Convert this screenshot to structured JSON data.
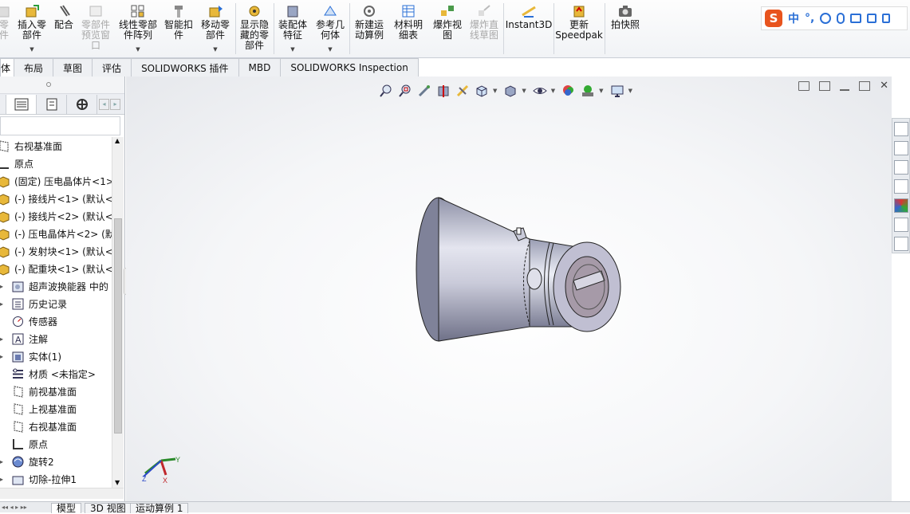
{
  "ribbon": {
    "buttons": [
      {
        "label": "零\n件",
        "disabled": true
      },
      {
        "label": "插入零\n部件",
        "disabled": false
      },
      {
        "label": "配合",
        "disabled": false
      },
      {
        "label": "零部件\n预览窗\n口",
        "disabled": true
      },
      {
        "label": "线性零部\n件阵列",
        "disabled": false
      },
      {
        "label": "智能扣\n件",
        "disabled": false
      },
      {
        "label": "移动零\n部件",
        "disabled": false
      },
      {
        "label": "显示隐\n藏的零\n部件",
        "disabled": false
      },
      {
        "label": "装配体\n特征",
        "disabled": false
      },
      {
        "label": "参考几\n何体",
        "disabled": false
      },
      {
        "label": "新建运\n动算例",
        "disabled": false
      },
      {
        "label": "材料明\n细表",
        "disabled": false
      },
      {
        "label": "爆炸视\n图",
        "disabled": false
      },
      {
        "label": "爆炸直\n线草图",
        "disabled": true
      },
      {
        "label": "Instant3D",
        "disabled": false
      },
      {
        "label": "更新\nSpeedpak",
        "disabled": false
      },
      {
        "label": "拍快照",
        "disabled": false
      }
    ]
  },
  "ime": {
    "mode": "中",
    "punct": "°,"
  },
  "tabs": [
    "体",
    "布局",
    "草图",
    "评估",
    "SOLIDWORKS 插件",
    "MBD",
    "SOLIDWORKS Inspection"
  ],
  "tree": [
    {
      "label": "右视基准面",
      "icon": "plane-icon"
    },
    {
      "label": "原点",
      "icon": "origin-icon"
    },
    {
      "label": "(固定) 压电晶体片<1>",
      "icon": "part-icon"
    },
    {
      "label": "(-) 接线片<1> (默认<",
      "icon": "part-icon"
    },
    {
      "label": "(-) 接线片<2> (默认<",
      "icon": "part-icon"
    },
    {
      "label": "(-) 压电晶体片<2> (默",
      "icon": "part-icon"
    },
    {
      "label": "(-) 发射块<1> (默认<",
      "icon": "part-icon"
    },
    {
      "label": "(-) 配重块<1> (默认<",
      "icon": "part-icon"
    },
    {
      "label": "超声波换能器 中的",
      "icon": "assembly-icon"
    },
    {
      "label": "历史记录",
      "icon": "history-icon"
    },
    {
      "label": "传感器",
      "icon": "sensor-icon"
    },
    {
      "label": "注解",
      "icon": "annotation-icon"
    },
    {
      "label": "实体(1)",
      "icon": "solid-body-icon"
    },
    {
      "label": "材质 <未指定>",
      "icon": "material-icon"
    },
    {
      "label": "前视基准面",
      "icon": "plane-icon"
    },
    {
      "label": "上视基准面",
      "icon": "plane-icon"
    },
    {
      "label": "右视基准面",
      "icon": "plane-icon"
    },
    {
      "label": "原点",
      "icon": "origin-icon"
    },
    {
      "label": "旋转2",
      "icon": "revolve-icon"
    },
    {
      "label": "切除-拉伸1",
      "icon": "cut-extrude-icon"
    }
  ],
  "bottom_tabs": [
    "模型",
    "3D 视图",
    "运动算例 1"
  ],
  "triad": {
    "x": "X",
    "y": "Y",
    "z": "Z"
  },
  "colors": {
    "accent": "#2a6fd6",
    "part": "#e8b83a",
    "model_body": "#bfc0d0"
  }
}
